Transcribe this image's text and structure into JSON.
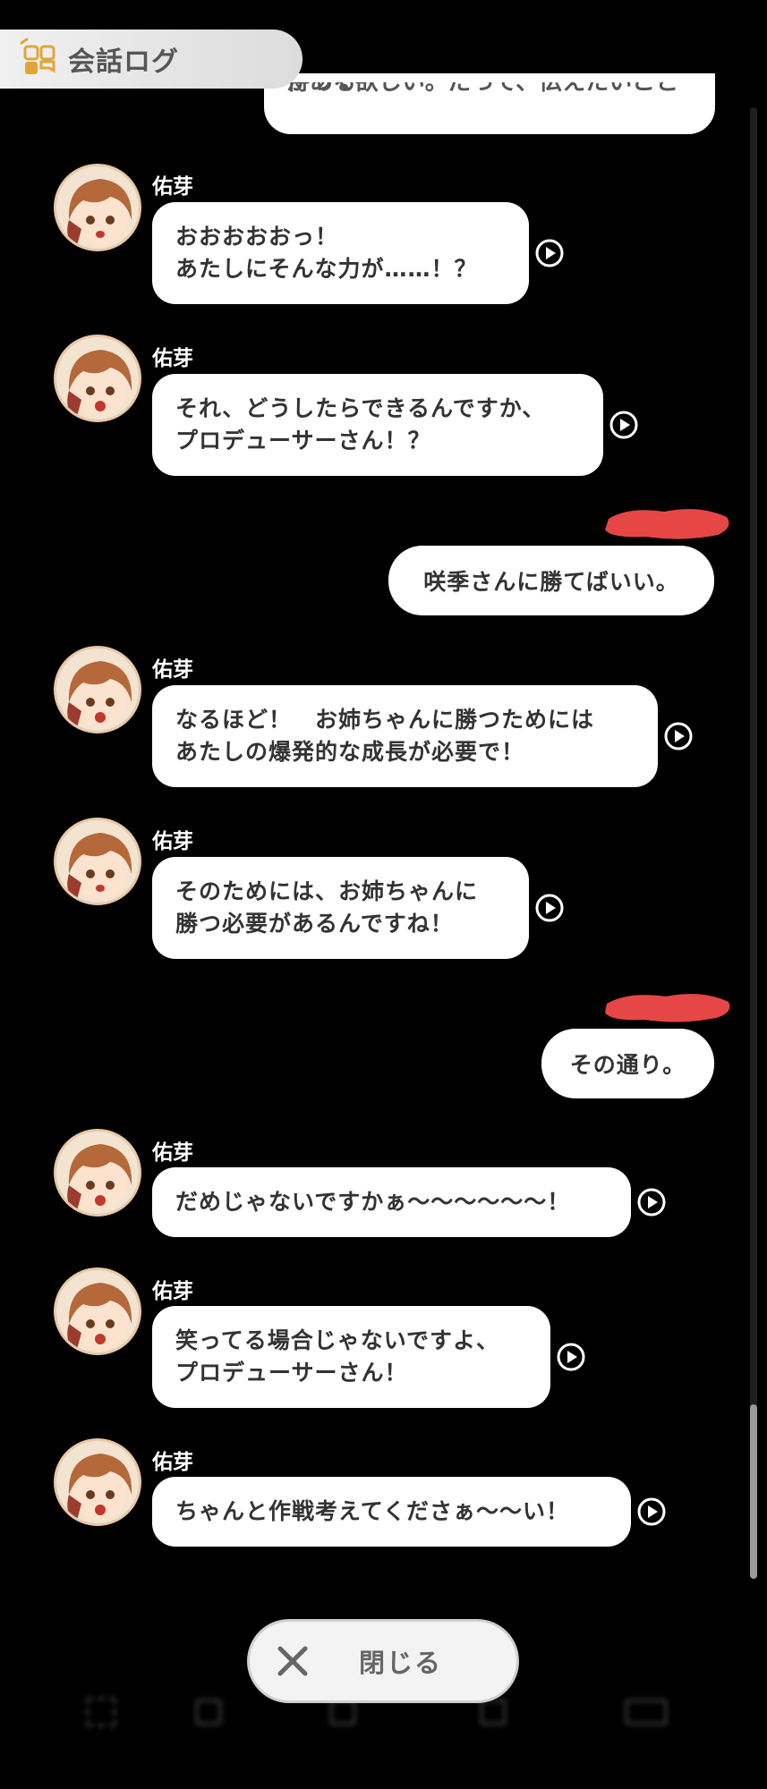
{
  "header": {
    "title": "会話ログ",
    "icon": "chat-log-icon"
  },
  "top_partial_text": "待って欲しい。だって、伝えたいことがある",
  "colors": {
    "background": "#000000",
    "bubble": "#ffffff",
    "text": "#333333",
    "redaction": "#e74646",
    "name": "#ffffff"
  },
  "messages": [
    {
      "speaker": "佑芽",
      "lines": [
        "おおおおおっ！",
        "あたしにそんな力が……！？"
      ]
    },
    {
      "speaker": "佑芽",
      "lines": [
        "それ、どうしたらできるんですか、",
        "プロデューサーさん！？"
      ]
    },
    {
      "speaker": "",
      "lines": [
        "咲季さんに勝てばいい。"
      ]
    },
    {
      "speaker": "佑芽",
      "lines": [
        "なるほど！　お姉ちゃんに勝つためには",
        "あたしの爆発的な成長が必要で！"
      ]
    },
    {
      "speaker": "佑芽",
      "lines": [
        "そのためには、お姉ちゃんに",
        "勝つ必要があるんですね！"
      ]
    },
    {
      "speaker": "",
      "lines": [
        "その通り。"
      ]
    },
    {
      "speaker": "佑芽",
      "lines": [
        "だめじゃないですかぁ～～～～～～！"
      ]
    },
    {
      "speaker": "佑芽",
      "lines": [
        "笑ってる場合じゃないですよ、",
        "プロデューサーさん！"
      ]
    },
    {
      "speaker": "佑芽",
      "lines": [
        "ちゃんと作戦考えてくださぁ～～い！"
      ]
    }
  ],
  "close_button": {
    "label": "閉じる"
  }
}
